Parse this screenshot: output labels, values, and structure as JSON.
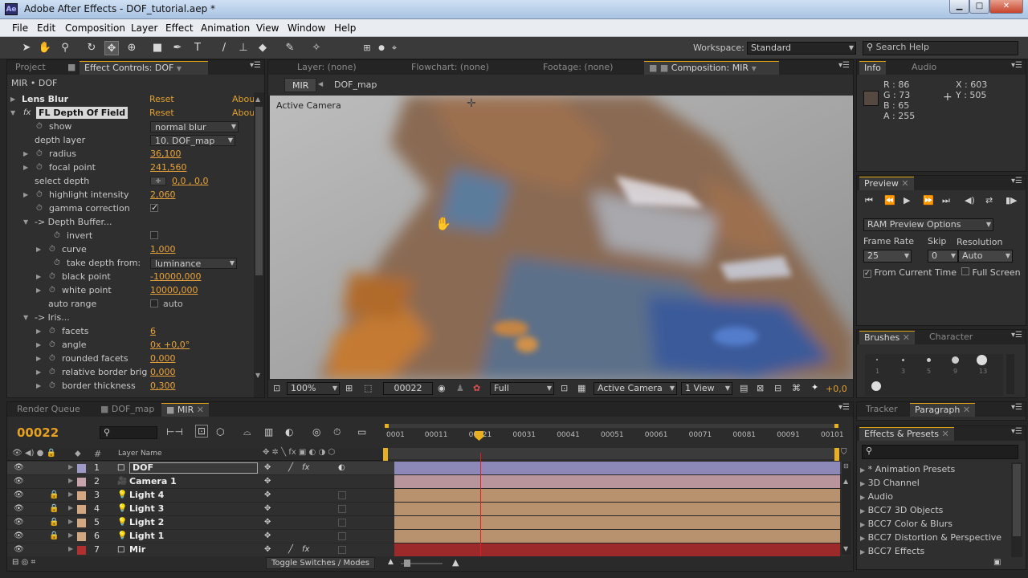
{
  "window": {
    "title": "Adobe After Effects - DOF_tutorial.aep *",
    "app_icon": "Ae",
    "btn_min": "▁",
    "btn_max": "□",
    "btn_close": "✕"
  },
  "menu": [
    "File",
    "Edit",
    "Composition",
    "Layer",
    "Effect",
    "Animation",
    "View",
    "Window",
    "Help"
  ],
  "toolbar": {
    "workspace_label": "Workspace:",
    "workspace_value": "Standard",
    "search_help_placeholder": "Search Help"
  },
  "left_panel": {
    "tabs": [
      "Project",
      "Effect Controls: DOF"
    ],
    "header": "MIR • DOF",
    "rows": [
      {
        "label": "Lens Blur",
        "value": "Reset",
        "extra": "Abou"
      },
      {
        "label": "FL Depth Of Field",
        "value": "Reset",
        "extra": "Abou"
      },
      {
        "label": "show",
        "value": "normal blur"
      },
      {
        "label": "depth layer",
        "value": "10. DOF_map"
      },
      {
        "label": "radius",
        "value": "36,100"
      },
      {
        "label": "focal point",
        "value": "241,560"
      },
      {
        "label": "select depth",
        "value": "0,0 , 0,0"
      },
      {
        "label": "highlight intensity",
        "value": "2,060"
      },
      {
        "label": "gamma correction",
        "value": "✓"
      },
      {
        "label": "-> Depth Buffer...",
        "value": ""
      },
      {
        "label": "invert",
        "value": ""
      },
      {
        "label": "curve",
        "value": "1,000"
      },
      {
        "label": "take depth from:",
        "value": "luminance"
      },
      {
        "label": "black point",
        "value": "-10000,000"
      },
      {
        "label": "white point",
        "value": "10000,000"
      },
      {
        "label": "auto range",
        "value": "auto"
      },
      {
        "label": "-> Iris...",
        "value": ""
      },
      {
        "label": "facets",
        "value": "6"
      },
      {
        "label": "angle",
        "value": "0x +0,0°"
      },
      {
        "label": "rounded facets",
        "value": "0,000"
      },
      {
        "label": "relative border brig",
        "value": "0,000"
      },
      {
        "label": "border thickness",
        "value": "0,300"
      }
    ]
  },
  "viewer": {
    "tabs": [
      "Layer: (none)",
      "Flowchart: (none)",
      "Footage: (none)",
      "Composition: MIR"
    ],
    "breadcrumbs": [
      "MIR",
      "DOF_map"
    ],
    "overlay_label": "Active Camera",
    "bottom": {
      "zoom": "100%",
      "timecode": "00022",
      "resolution": "Full",
      "camera": "Active Camera",
      "views": "1 View",
      "exposure": "+0,0"
    }
  },
  "info_panel": {
    "tabs": [
      "Info",
      "Audio"
    ],
    "r": "R : 86",
    "g": "G : 73",
    "b": "B : 65",
    "a": "A : 255",
    "x": "X : 603",
    "y": "Y : 505",
    "swatch_color": "#564941"
  },
  "preview_panel": {
    "tab": "Preview",
    "ram_options": "RAM Preview Options",
    "frame_rate_label": "Frame Rate",
    "skip_label": "Skip",
    "resolution_label": "Resolution",
    "frame_rate": "25",
    "skip": "0",
    "resolution": "Auto",
    "from_current": "From Current Time",
    "full_screen": "Full Screen"
  },
  "brushes_panel": {
    "tabs": [
      "Brushes",
      "Character"
    ],
    "sizes": [
      "1",
      "3",
      "5",
      "9",
      "13"
    ]
  },
  "tracker_panel": {
    "tabs": [
      "Tracker",
      "Paragraph"
    ]
  },
  "effects_panel": {
    "tab": "Effects & Presets",
    "items": [
      "* Animation Presets",
      "3D Channel",
      "Audio",
      "BCC7 3D Objects",
      "BCC7 Color & Blurs",
      "BCC7 Distortion & Perspective",
      "BCC7 Effects"
    ]
  },
  "timeline": {
    "tabs": [
      "Render Queue",
      "DOF_map",
      "MIR"
    ],
    "timecode": "00022",
    "search_placeholder": "",
    "col_layer_name": "Layer Name",
    "col_number": "#",
    "ruler": [
      "0001",
      "00011",
      "00021",
      "00031",
      "00041",
      "00051",
      "00061",
      "00071",
      "00081",
      "00091",
      "00101"
    ],
    "layers": [
      {
        "num": "1",
        "name": "DOF",
        "color": "#9d9ac8",
        "bar": "#8c89b8"
      },
      {
        "num": "2",
        "name": "Camera 1",
        "color": "#c9a3ab",
        "bar": "#b8959c"
      },
      {
        "num": "3",
        "name": "Light 4",
        "color": "#d2a781",
        "bar": "#b8926f"
      },
      {
        "num": "4",
        "name": "Light 3",
        "color": "#d2a781",
        "bar": "#b8926f"
      },
      {
        "num": "5",
        "name": "Light 2",
        "color": "#d2a781",
        "bar": "#b8926f"
      },
      {
        "num": "6",
        "name": "Light 1",
        "color": "#d2a781",
        "bar": "#b8926f"
      },
      {
        "num": "7",
        "name": "Mir",
        "color": "#b03030",
        "bar": "#9c2a2a"
      }
    ],
    "toggle_label": "Toggle Switches / Modes"
  }
}
